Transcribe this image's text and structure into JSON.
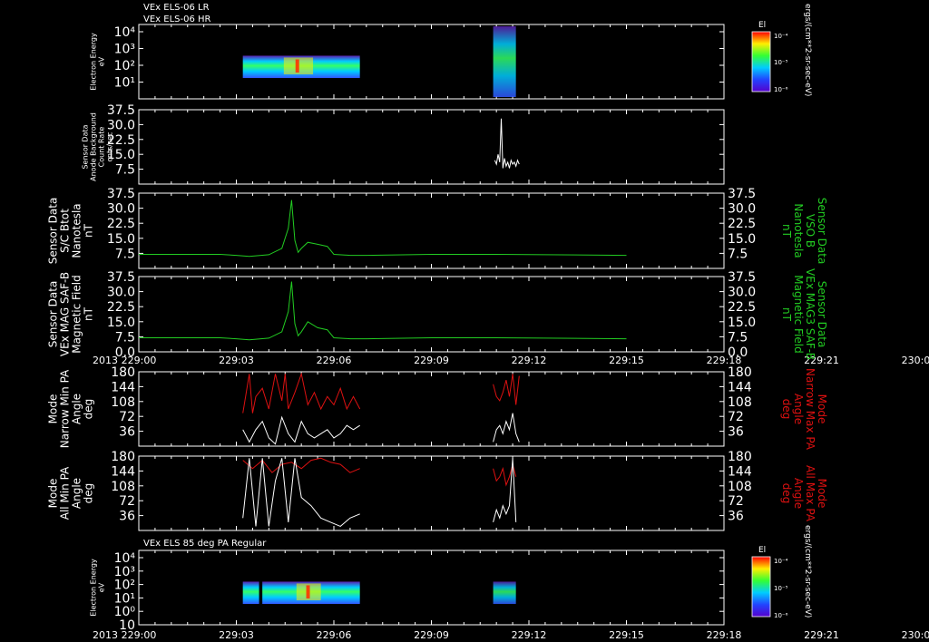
{
  "header": {
    "line1": "VEx ELS-06 LR",
    "line2": "VEx ELS-06 HR",
    "bottom_panel_title": "VEx ELS 85 deg PA Regular"
  },
  "colorbar": {
    "label": "El",
    "ticks": [
      "10⁻⁴",
      "10⁻⁵",
      "10⁻⁶"
    ],
    "unit_top": "ergs/(cm**2-sr-sec-eV)",
    "unit_bottom": "ergs/(cm**2-sr-sec-eV)"
  },
  "time_axis": {
    "year": "2013",
    "ticks": [
      "229:00",
      "229:03",
      "229:06",
      "229:09",
      "229:12",
      "229:15",
      "229:18",
      "229:21",
      "230:00"
    ]
  },
  "colors": {
    "background": "#000000",
    "axes": "#ffffff",
    "green": "#22cc22",
    "red": "#dd1111",
    "white": "#ffffff"
  },
  "chart_data": [
    {
      "type": "heatmap",
      "ylabel": [
        "Electron Energy",
        "eV"
      ],
      "ytick_labels": [
        "10⁴",
        "10³",
        "10²",
        "10¹"
      ],
      "scale": "log",
      "color_scale": [
        "#5b1fb0",
        "#3355ff",
        "#00ccff",
        "#33ff66",
        "#ffee00",
        "#ff6600",
        "#ff0000"
      ],
      "blocks": [
        {
          "x_start": 3.2,
          "x_end": 6.8,
          "e_min": 5,
          "e_max": 150,
          "level": 3.2
        },
        {
          "x_start": 10.9,
          "x_end": 11.6,
          "e_min": 3,
          "e_max": 2000,
          "level": 1.5
        }
      ]
    },
    {
      "type": "line",
      "ylabel": [
        "Sensor Data",
        "Anode Background",
        "Count Rate",
        "cnts/sec"
      ],
      "ytick_labels": [
        "37.5",
        "30.0",
        "22.5",
        "15.0",
        "7.5"
      ],
      "ylim": [
        0,
        37.5
      ],
      "series": [
        {
          "color": "white",
          "x": [
            10.95,
            11.0,
            11.05,
            11.1,
            11.15,
            11.2,
            11.25,
            11.3,
            11.35,
            11.4,
            11.45,
            11.5,
            11.55,
            11.6,
            11.65,
            11.7
          ],
          "y": [
            12,
            10,
            15,
            11,
            33,
            8,
            13,
            9,
            11,
            8,
            12,
            10,
            11,
            9,
            12,
            10
          ]
        }
      ]
    },
    {
      "type": "line",
      "ylabel": [
        "Sensor Data",
        "S/C Btot",
        "Nanotesla",
        "nT"
      ],
      "right_label": [
        "Sensor Data",
        "VSO B",
        "Nanotesla",
        "nT"
      ],
      "ytick_labels": [
        "37.5",
        "30.0",
        "22.5",
        "15.0",
        "7.5"
      ],
      "ylim": [
        0,
        37.5
      ],
      "series": [
        {
          "color": "green",
          "x": [
            0,
            2.5,
            3.0,
            3.4,
            4.0,
            4.4,
            4.6,
            4.7,
            4.8,
            4.9,
            5.0,
            5.2,
            5.5,
            5.8,
            6.0,
            6.5,
            7.0,
            9.0,
            11.0,
            15.0
          ],
          "y": [
            7,
            7,
            6.5,
            6,
            6.8,
            10,
            20,
            34,
            14,
            8,
            10,
            13,
            12,
            11,
            7,
            6.5,
            6.5,
            7,
            7,
            6.5
          ]
        }
      ]
    },
    {
      "type": "line",
      "ylabel": [
        "Sensor Data",
        "VEx MAG SAF-B",
        "Magnetic Field",
        "nT"
      ],
      "right_label": [
        "Sensor Data",
        "VEx MAG3 SAF-B",
        "Magnetic Field",
        "nT"
      ],
      "ytick_labels": [
        "37.5",
        "30.0",
        "22.5",
        "15.0",
        "7.5",
        "0.0"
      ],
      "ylim": [
        0,
        37.5
      ],
      "series": [
        {
          "color": "green",
          "x": [
            0,
            2.5,
            3.0,
            3.4,
            4.0,
            4.4,
            4.6,
            4.7,
            4.8,
            4.9,
            5.0,
            5.2,
            5.5,
            5.8,
            6.0,
            6.5,
            7.0,
            9.0,
            11.0,
            15.0
          ],
          "y": [
            7,
            7,
            6.5,
            6,
            6.8,
            10,
            20,
            35,
            14,
            8,
            10,
            15,
            12,
            11,
            7,
            6.5,
            6.5,
            7,
            7,
            6.5
          ]
        }
      ]
    },
    {
      "type": "line",
      "ylabel": [
        "Mode",
        "Narrow Min PA",
        "Angle",
        "deg"
      ],
      "right_label": [
        "Mode",
        "Narrow Max PA",
        "Angle",
        "deg"
      ],
      "ytick_labels": [
        "180",
        "144",
        "108",
        "72",
        "36"
      ],
      "ylim": [
        0,
        180
      ],
      "series": [
        {
          "color": "red",
          "x": [
            3.2,
            3.4,
            3.5,
            3.6,
            3.8,
            4.0,
            4.2,
            4.4,
            4.5,
            4.6,
            4.8,
            5.0,
            5.2,
            5.4,
            5.6,
            5.8,
            6.0,
            6.2,
            6.4,
            6.6,
            6.8
          ],
          "y": [
            80,
            175,
            80,
            120,
            140,
            90,
            175,
            110,
            175,
            90,
            130,
            175,
            100,
            130,
            90,
            120,
            100,
            140,
            90,
            120,
            90
          ]
        },
        {
          "color": "white",
          "x": [
            3.2,
            3.4,
            3.6,
            3.8,
            4.0,
            4.2,
            4.4,
            4.6,
            4.8,
            5.0,
            5.2,
            5.4,
            5.6,
            5.8,
            6.0,
            6.2,
            6.4,
            6.6,
            6.8
          ],
          "y": [
            40,
            10,
            40,
            60,
            20,
            5,
            70,
            30,
            10,
            60,
            30,
            20,
            30,
            40,
            20,
            30,
            50,
            40,
            50
          ]
        },
        {
          "color": "red",
          "x": [
            10.9,
            11.0,
            11.1,
            11.2,
            11.3,
            11.4,
            11.5,
            11.6,
            11.7
          ],
          "y": [
            150,
            120,
            110,
            130,
            160,
            120,
            175,
            100,
            170
          ]
        },
        {
          "color": "white",
          "x": [
            10.9,
            11.0,
            11.1,
            11.2,
            11.3,
            11.4,
            11.5,
            11.6,
            11.7
          ],
          "y": [
            10,
            40,
            50,
            30,
            60,
            40,
            80,
            30,
            10
          ]
        }
      ]
    },
    {
      "type": "line",
      "ylabel": [
        "Mode",
        "All Min PA",
        "Angle",
        "deg"
      ],
      "right_label": [
        "Mode",
        "All Max PA",
        "Angle",
        "deg"
      ],
      "ytick_labels": [
        "180",
        "144",
        "108",
        "72",
        "36"
      ],
      "ylim": [
        0,
        180
      ],
      "series": [
        {
          "color": "red",
          "x": [
            3.2,
            3.5,
            3.8,
            4.1,
            4.4,
            4.7,
            5.0,
            5.3,
            5.6,
            5.9,
            6.2,
            6.5,
            6.8
          ],
          "y": [
            170,
            150,
            170,
            140,
            160,
            165,
            150,
            170,
            175,
            165,
            160,
            140,
            150
          ]
        },
        {
          "color": "white",
          "x": [
            3.2,
            3.4,
            3.6,
            3.8,
            4.0,
            4.2,
            4.4,
            4.6,
            4.8,
            5.0,
            5.3,
            5.6,
            5.9,
            6.2,
            6.5,
            6.8
          ],
          "y": [
            30,
            175,
            10,
            175,
            10,
            120,
            175,
            20,
            175,
            80,
            60,
            30,
            20,
            10,
            30,
            40
          ]
        },
        {
          "color": "red",
          "x": [
            10.9,
            11.0,
            11.1,
            11.2,
            11.3,
            11.4,
            11.5,
            11.6
          ],
          "y": [
            150,
            120,
            130,
            150,
            110,
            130,
            160,
            130
          ]
        },
        {
          "color": "white",
          "x": [
            10.9,
            11.0,
            11.1,
            11.2,
            11.3,
            11.4,
            11.5,
            11.6
          ],
          "y": [
            20,
            50,
            30,
            60,
            40,
            60,
            175,
            20
          ]
        }
      ]
    },
    {
      "type": "heatmap",
      "ylabel": [
        "Electron Energy",
        "eV"
      ],
      "ytick_labels": [
        "10⁴",
        "10³",
        "10²",
        "10¹",
        "10⁰",
        "10"
      ],
      "scale": "log",
      "color_scale": [
        "#5b1fb0",
        "#3355ff",
        "#00ccff",
        "#33ff66",
        "#ffee00",
        "#ff6600",
        "#ff0000"
      ],
      "blocks": [
        {
          "x_start": 3.2,
          "x_end": 3.7,
          "e_min": 5,
          "e_max": 150,
          "level": 3.0
        },
        {
          "x_start": 3.8,
          "x_end": 6.8,
          "e_min": 5,
          "e_max": 150,
          "level": 3.3
        },
        {
          "x_start": 10.9,
          "x_end": 11.6,
          "e_min": 3,
          "e_max": 150,
          "level": 1.5
        }
      ]
    }
  ]
}
